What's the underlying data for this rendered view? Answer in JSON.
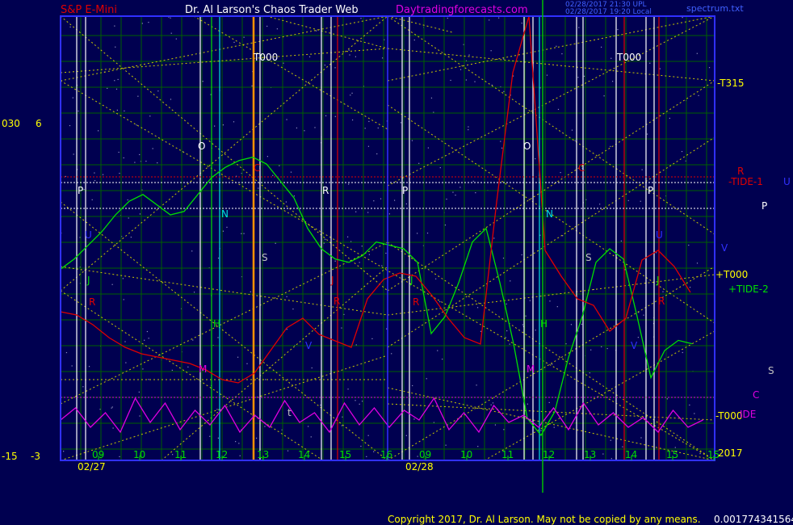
{
  "header": {
    "symbol": "S&P E-Mini",
    "title": "Dr. Al Larson's Chaos Trader Web",
    "site": "Daytradingforecasts.com",
    "stamp_1": "02/28/2017 21:30 UPL",
    "stamp_2": "02/28/2017 19:20 Local",
    "file": "spectrum.txt"
  },
  "footer": {
    "copyright": "Copyright 2017, Dr. Al Larson. May not be copied by any means.",
    "counter": "0.0017743415647"
  },
  "left_scale": {
    "top_a": "030",
    "top_b": "6",
    "bottom_a": "-15",
    "bottom_b": "-3"
  },
  "right_labels": {
    "t315": "-T315",
    "r": "R",
    "tide1": "-TIDE-1",
    "u": "U",
    "p": "P",
    "v": "V",
    "t000_mid": "+T000",
    "tide2": "+TIDE-2",
    "s": "S",
    "c": "C",
    "t000_low": "-T000",
    "ide": "IDE",
    "year": "2017"
  },
  "colors": {
    "background": "#000050",
    "frame": "#3030ff",
    "grid": "#006000",
    "fan": "#c8c800",
    "green_line": "#00e000",
    "red_line": "#e00000",
    "magenta_line": "#e000e0",
    "orange_line": "#ff9000",
    "cyan_line": "#00e0e0",
    "white_line": "#ffffff"
  },
  "chart_data": {
    "type": "line",
    "x_axis": {
      "dates": [
        "02/27",
        "02/28"
      ],
      "hour_ticks_day1": [
        "09",
        "10",
        "11",
        "12",
        "13",
        "14",
        "15",
        "16"
      ],
      "hour_ticks_day2": [
        "09",
        "10",
        "11",
        "12",
        "13",
        "14",
        "15",
        "15"
      ]
    },
    "series": [
      {
        "color": "green",
        "values": [
          54,
          57,
          61,
          65,
          70,
          74,
          76,
          73,
          70,
          71,
          76,
          81,
          84,
          86,
          87,
          85,
          80,
          75,
          66,
          60,
          57,
          56,
          58,
          62,
          61,
          60,
          56,
          35,
          40,
          50,
          62,
          66,
          50,
          32,
          10,
          5,
          12,
          28,
          40,
          56,
          60,
          57,
          40,
          22,
          30,
          33,
          32
        ]
      },
      {
        "color": "red",
        "values": [
          46,
          45,
          42,
          38,
          35,
          33,
          32,
          31,
          30,
          28,
          25,
          24,
          27,
          34,
          41,
          44,
          39,
          37,
          35,
          50,
          56,
          58,
          57,
          51,
          44,
          38,
          36,
          80,
          120,
          150,
          65,
          57,
          50,
          48,
          40,
          44,
          62,
          65,
          60,
          52
        ]
      },
      {
        "color": "magenta",
        "values": [
          15,
          20,
          12,
          18,
          10,
          24,
          14,
          22,
          11,
          19,
          13,
          21,
          10,
          17,
          12,
          23,
          14,
          18,
          10,
          22,
          13,
          20,
          12,
          19,
          15,
          24,
          11,
          18,
          10,
          21,
          14,
          17,
          12,
          20,
          11,
          22,
          13,
          18,
          12,
          16,
          10,
          19,
          12,
          15
        ]
      }
    ]
  },
  "grid_labels": {
    "p": "P",
    "o": "O",
    "c": "C",
    "r": "R",
    "n": "N",
    "s": "S",
    "j": "J",
    "h": "H",
    "m": "M",
    "v": "V",
    "u": "U",
    "t_small": "t",
    "t000": "T000"
  }
}
